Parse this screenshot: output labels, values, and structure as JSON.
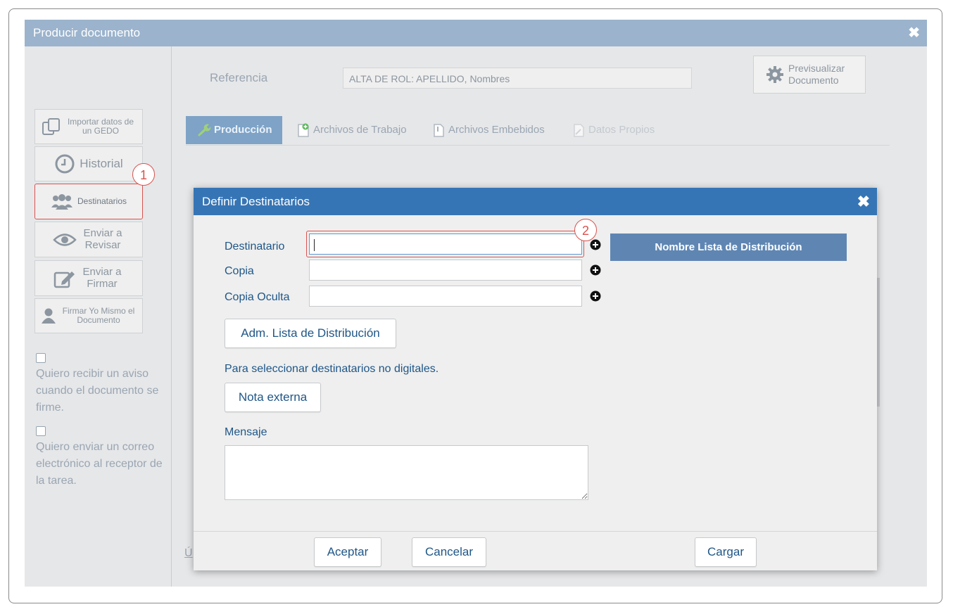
{
  "window": {
    "title": "Producir documento",
    "close_glyph": "✖"
  },
  "sidebar": {
    "import_label": "Importar datos de un GEDO",
    "history_label": "Historial",
    "recipients_label": "Destinatarios",
    "review_label": "Enviar a Revisar",
    "sign_label": "Enviar a Firmar",
    "selfsign_label": "Firmar Yo Mismo el Documento",
    "notify_text": "Quiero recibir un aviso cuando el documento se firme.",
    "email_text": "Quiero enviar un correo electrónico al receptor de la tarea."
  },
  "annotations": {
    "badge1": "1",
    "badge2": "2",
    "highlight_color": "#d9534f"
  },
  "main": {
    "reference_label": "Referencia",
    "reference_value": "ALTA DE ROL: APELLIDO, Nombres",
    "preview_label": "Previsualizar Documento",
    "tabs": [
      {
        "label": "Producción",
        "icon": "wrench-icon",
        "active": true
      },
      {
        "label": "Archivos de Trabajo",
        "icon": "file-add-icon"
      },
      {
        "label": "Archivos Embebidos",
        "icon": "attachment-icon"
      },
      {
        "label": "Datos Propios",
        "icon": "pencil-doc-icon",
        "disabled": true
      }
    ],
    "ultimo_fragment": "Ú"
  },
  "dialog": {
    "title": "Definir Destinatarios",
    "close_glyph": "✖",
    "recipient_label": "Destinatario",
    "recipient_value": "",
    "copy_label": "Copia",
    "copy_value": "",
    "hidden_copy_label": "Copia Oculta",
    "hidden_copy_value": "",
    "list_header": "Nombre Lista de Distribución",
    "adm_list_button": "Adm. Lista de Distribución",
    "non_digital_note": "Para seleccionar destinatarios no digitales.",
    "external_note_button": "Nota externa",
    "message_label": "Mensaje",
    "message_value": "",
    "accept_button": "Aceptar",
    "cancel_button": "Cancelar",
    "load_button": "Cargar",
    "title_bar_color": "#3675b5",
    "list_header_color": "#5f86b3"
  }
}
